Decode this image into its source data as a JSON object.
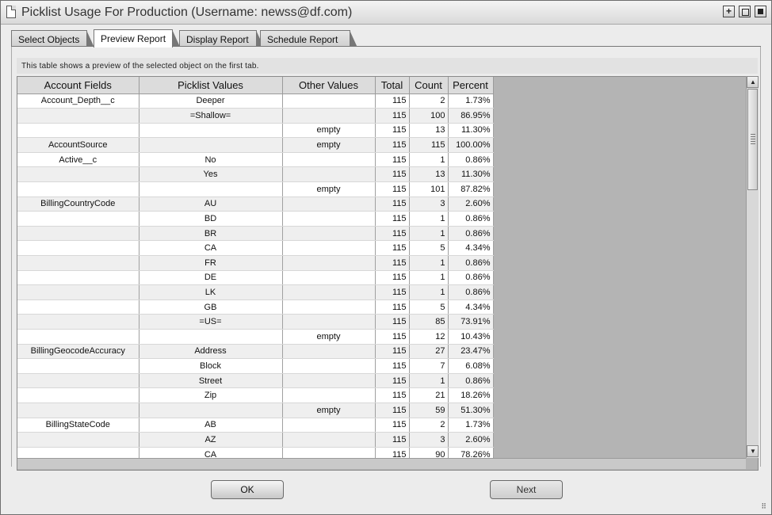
{
  "window": {
    "title": "Picklist Usage For Production (Username: newss@df.com)",
    "buttons": [
      "add",
      "maximize",
      "close"
    ]
  },
  "tabs": [
    {
      "label": "Select Objects",
      "active": false
    },
    {
      "label": "Preview Report",
      "active": true
    },
    {
      "label": "Display Report",
      "active": false
    },
    {
      "label": "Schedule Report",
      "active": false
    }
  ],
  "info_text": "This table shows a preview of the selected object on the first tab.",
  "table": {
    "columns": [
      "Account Fields",
      "Picklist Values",
      "Other Values",
      "Total",
      "Count",
      "Percent"
    ],
    "rows": [
      [
        "Account_Depth__c",
        "Deeper",
        "",
        "115",
        "2",
        "1.73%"
      ],
      [
        "",
        "=Shallow=",
        "",
        "115",
        "100",
        "86.95%"
      ],
      [
        "",
        "",
        "empty",
        "115",
        "13",
        "11.30%"
      ],
      [
        "AccountSource",
        "",
        "empty",
        "115",
        "115",
        "100.00%"
      ],
      [
        "Active__c",
        "No",
        "",
        "115",
        "1",
        "0.86%"
      ],
      [
        "",
        "Yes",
        "",
        "115",
        "13",
        "11.30%"
      ],
      [
        "",
        "",
        "empty",
        "115",
        "101",
        "87.82%"
      ],
      [
        "BillingCountryCode",
        "AU",
        "",
        "115",
        "3",
        "2.60%"
      ],
      [
        "",
        "BD",
        "",
        "115",
        "1",
        "0.86%"
      ],
      [
        "",
        "BR",
        "",
        "115",
        "1",
        "0.86%"
      ],
      [
        "",
        "CA",
        "",
        "115",
        "5",
        "4.34%"
      ],
      [
        "",
        "FR",
        "",
        "115",
        "1",
        "0.86%"
      ],
      [
        "",
        "DE",
        "",
        "115",
        "1",
        "0.86%"
      ],
      [
        "",
        "LK",
        "",
        "115",
        "1",
        "0.86%"
      ],
      [
        "",
        "GB",
        "",
        "115",
        "5",
        "4.34%"
      ],
      [
        "",
        "=US=",
        "",
        "115",
        "85",
        "73.91%"
      ],
      [
        "",
        "",
        "empty",
        "115",
        "12",
        "10.43%"
      ],
      [
        "BillingGeocodeAccuracy",
        "Address",
        "",
        "115",
        "27",
        "23.47%"
      ],
      [
        "",
        "Block",
        "",
        "115",
        "7",
        "6.08%"
      ],
      [
        "",
        "Street",
        "",
        "115",
        "1",
        "0.86%"
      ],
      [
        "",
        "Zip",
        "",
        "115",
        "21",
        "18.26%"
      ],
      [
        "",
        "",
        "empty",
        "115",
        "59",
        "51.30%"
      ],
      [
        "BillingStateCode",
        "AB",
        "",
        "115",
        "2",
        "1.73%"
      ],
      [
        "",
        "AZ",
        "",
        "115",
        "3",
        "2.60%"
      ],
      [
        "",
        "CA",
        "",
        "115",
        "90",
        "78.26%"
      ]
    ]
  },
  "footer": {
    "ok_label": "OK",
    "next_label": "Next"
  }
}
